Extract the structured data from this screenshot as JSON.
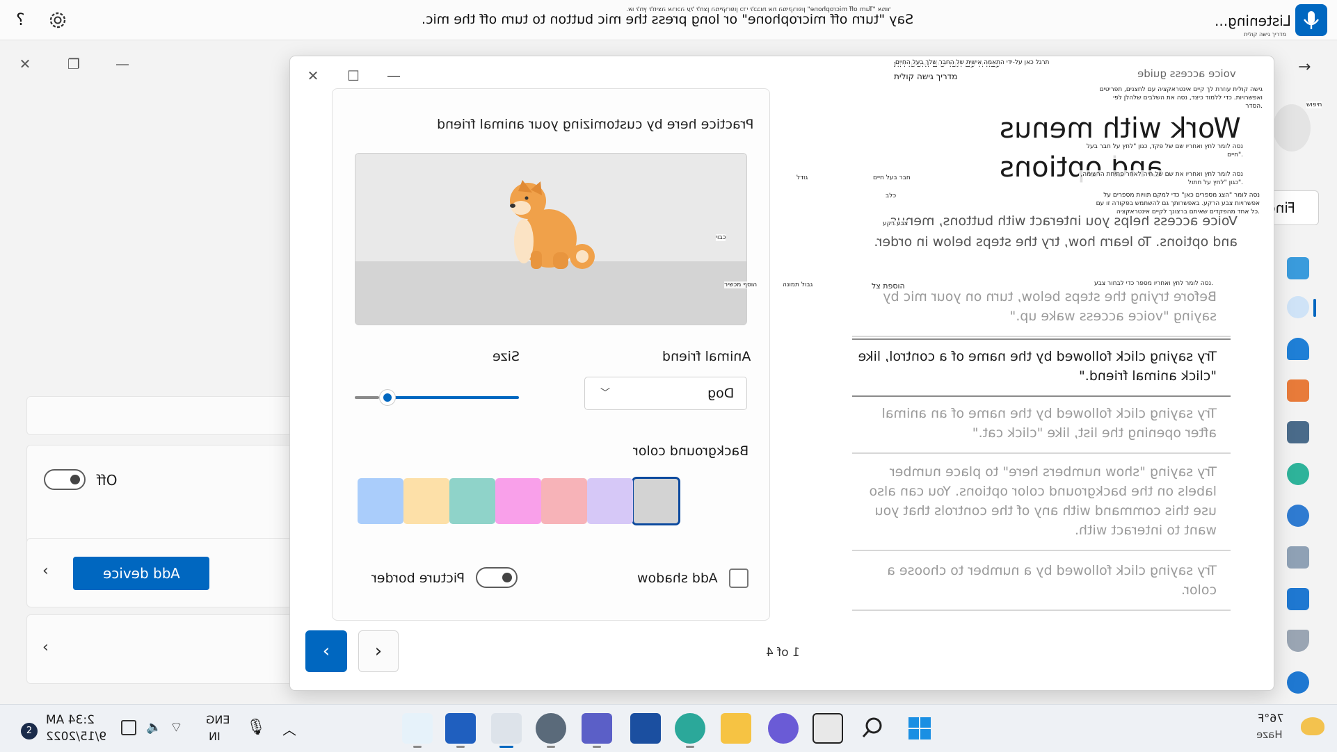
{
  "voice_bar": {
    "message": "Say \"turn off microphone\" or long press the mic button to turn off the mic.",
    "message_hebrew": "אמור \"Turn off microphone\" או לחץ לחיצה ארוכה על לחצן המיקרופון כדי לכבות את המיקרופון.",
    "status": "Listening...",
    "status_hebrew": "מדריך גישה קולית",
    "help_glyph": "?"
  },
  "settings_window": {
    "toggle_label": "Off",
    "add_device_label": "Add device",
    "find_label": "Find"
  },
  "guide": {
    "title": "voice access guide",
    "heading": "Work with menus and options",
    "heading_hebrew": "עבודה עם תפריטים ואפשרויות",
    "intro": "Voice access helps you interact with buttons, menus, and options. To learn how, try the steps below in order.",
    "steps": [
      "Before trying the steps below, turn on your mic by saying \"voice access wake up.\"",
      "Try saying click followed by the name of a control, like \"click animal friend.\"",
      "Try saying click followed by the name of an animal after opening the list, like \"click cat.\"",
      "Try saying \"show numbers here\" to place number labels on the background color options. You can also use this command with any of the controls that you want to interact with.",
      "Try saying click followed by a number to choose a color."
    ],
    "page_indicator": "1 of 4",
    "practice": {
      "title": "Practice here by customizing your animal friend",
      "animal_label": "Animal friend",
      "animal_value": "Dog",
      "size_label": "Size",
      "size_value": 0.2,
      "bgcolor_label": "Background color",
      "swatches": [
        "#d3d3d3",
        "#d6c8f7",
        "#f7b3b8",
        "#f9a0ea",
        "#8fd3c9",
        "#fde0a8",
        "#aacdfb"
      ],
      "selected_swatch": 0,
      "shadow_label": "Add shadow",
      "border_label": "Picture border"
    },
    "hebrew_tags": {
      "t1": "תרגל כאן על-ידי התאמה אישית של החבר שלך בעל החיים",
      "t2": "חבר בעל חיים",
      "t3": "גודל",
      "t4": "כלב",
      "t5": "צבע רקע",
      "t6": "כבוי",
      "t7": "הוסף מכשיר",
      "t8": "הוספת צל",
      "t9": "גבול תמונה",
      "t10": "גישה קולית עוזרת לך קיים אינטראקציה עם לחצנים, תפריטים ואפשרויות. כדי ללמוד כיצד, נסה את השלבים שלהלן לפי הסדר.",
      "t11": "נסה לומר לחץ ואחריו שם של פקד, כגון \"לחץ על חבר בעל חיים\".",
      "t12": "נסה לומר לחץ ואחריו את שם של חיה לאחר פתיחת הרשימה, כגון \"לחץ על חתול\".",
      "t13": "נסה לומר \"הצג מספרים כאן\" כדי למקם תוויות מספרים על אפשרויות צבע הרקע. באפשרותך גם להשתמש בפקודה זו עם כל אחד מהפקדים שאיתם ברצונך לקיים אינטראקציה.",
      "t14": "נסה לומר לחץ ואחריו מספר כדי לבחור צבע.",
      "t15": "חיפוש"
    }
  },
  "taskbar": {
    "time": "2:34 AM",
    "date": "9/15/2022",
    "notification_count": "2",
    "lang1": "ENG",
    "lang2": "IN",
    "temperature": "76°F",
    "weather": "Haze"
  }
}
